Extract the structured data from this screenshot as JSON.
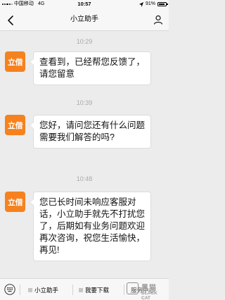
{
  "status_bar": {
    "carrier": "中国移动",
    "network": "4G",
    "time": "10:57",
    "battery_pct": "91%",
    "battery_level": 0.91
  },
  "nav": {
    "title": "小立助手"
  },
  "messages": [
    {
      "time": "10:29",
      "avatar_text": "立借",
      "text": "查看到，已经帮您反馈了，请您留意"
    },
    {
      "time": "10:39",
      "avatar_text": "立借",
      "text": "您好，请问您还有什么问题需要我们解答的吗?"
    },
    {
      "time": "10:48",
      "avatar_text": "立借",
      "text": "您已长时间未响应客服对话，小立助手就先不打扰您了，后期如有业务问题欢迎再次咨询，祝您生活愉快，再见!"
    }
  ],
  "bottom_bar": {
    "menu": [
      "小立助手",
      "我要下载",
      "服务中心"
    ]
  },
  "watermark": {
    "cn": "黑猫",
    "en": "BLACK CAT"
  },
  "colors": {
    "avatar": "#f5821f",
    "background": "#ececec"
  }
}
